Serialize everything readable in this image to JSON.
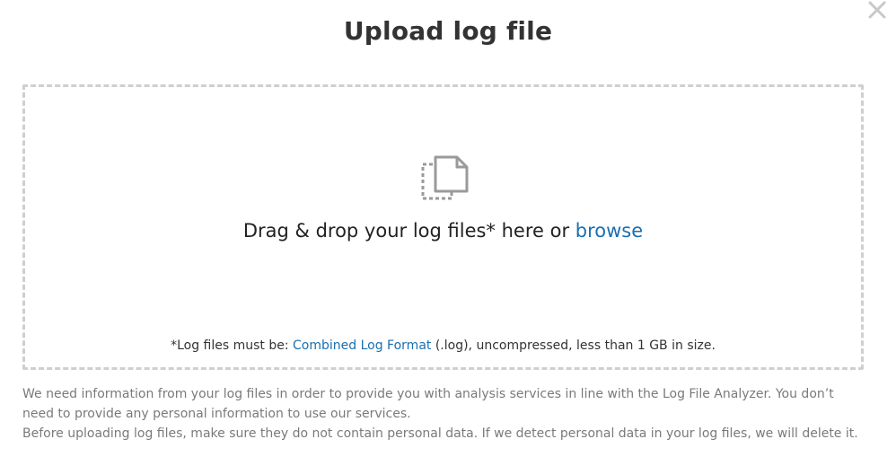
{
  "dialog": {
    "title": "Upload log file",
    "close_icon": "close-icon"
  },
  "dropzone": {
    "icon": "file-icon",
    "drop_text": "Drag & drop your log files* here or ",
    "browse_link": "browse",
    "requirements_prefix": "*Log files must be: ",
    "format_link": "Combined Log Format",
    "requirements_suffix": " (.log), uncompressed, less than 1 GB in size."
  },
  "disclaimer": {
    "line1": "We need information from your log files in order to provide you with analysis services in line with the Log File Analyzer. You don’t need to provide any personal information to use our services.",
    "line2": "Before uploading log files, make sure they do not contain personal data. If we detect personal data in your log files, we will delete it."
  },
  "colors": {
    "link": "#1a6fb0",
    "dashed_border": "#cfcfcf",
    "icon_gray": "#9a9a9a",
    "disclaimer_text": "#7a7a7a"
  }
}
